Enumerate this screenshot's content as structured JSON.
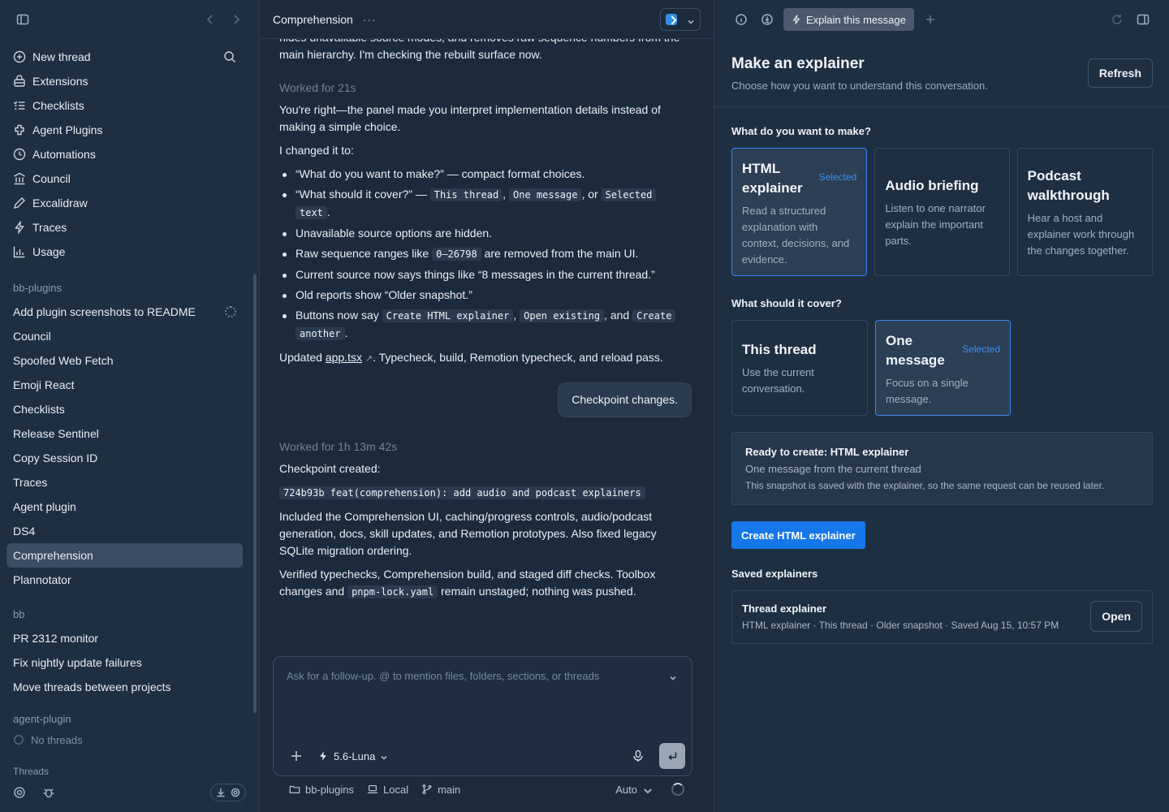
{
  "sidebar": {
    "nav": [
      {
        "label": "New thread",
        "icon": "plus-circle-icon"
      },
      {
        "label": "Extensions",
        "icon": "extensions-icon"
      },
      {
        "label": "Checklists",
        "icon": "checklist-icon"
      },
      {
        "label": "Agent Plugins",
        "icon": "plugin-icon"
      },
      {
        "label": "Automations",
        "icon": "clock-icon"
      },
      {
        "label": "Council",
        "icon": "council-icon"
      },
      {
        "label": "Excalidraw",
        "icon": "pen-icon"
      },
      {
        "label": "Traces",
        "icon": "bolt-icon"
      },
      {
        "label": "Usage",
        "icon": "chart-icon"
      }
    ],
    "groups": [
      {
        "label": "bb-plugins",
        "threads": [
          "Add plugin screenshots to README",
          "Council",
          "Spoofed Web Fetch",
          "Emoji React",
          "Checklists",
          "Release Sentinel",
          "Copy Session ID",
          "Traces",
          "Agent plugin",
          "DS4",
          "Comprehension",
          "Plannotator"
        ]
      },
      {
        "label": "bb",
        "threads": [
          "PR 2312 monitor",
          "Fix nightly update failures",
          "Move threads between projects"
        ]
      },
      {
        "label": "agent-plugin",
        "threads": [
          "No threads"
        ]
      }
    ],
    "cut_label": "Threads"
  },
  "chat": {
    "title": "Comprehension",
    "top_text": "hides unavailable source modes, and removes raw sequence numbers from the main hierarchy. I'm checking the rebuilt surface now.",
    "worked1": "Worked for 21s",
    "p1": "You're right—the panel made you interpret implementation details instead of making a simple choice.",
    "p2": "I changed it to:",
    "bullets": {
      "b1": "“What do you want to make?” — compact format choices.",
      "b2_pre": "“What should it cover?” — ",
      "b2_c1": "This thread",
      "b2_sep1": ", ",
      "b2_c2": "One message",
      "b2_sep2": ", or ",
      "b2_c3a": "Selected",
      "b2_c3b": "text",
      "b2_end": ".",
      "b3": "Unavailable source options are hidden.",
      "b4_pre": "Raw sequence ranges like ",
      "b4_code": "0–26798",
      "b4_post": " are removed from the main UI.",
      "b5": "Current source now says things like “8 messages in the current thread.”",
      "b6": "Old reports show “Older snapshot.”",
      "b7_pre": "Buttons now say ",
      "b7_c1": "Create HTML explainer",
      "b7_sep1": ", ",
      "b7_c2": "Open existing",
      "b7_sep2": ", and ",
      "b7_c3a": "Create",
      "b7_c3b": "another",
      "b7_end": "."
    },
    "updated_pre": "Updated ",
    "updated_link": "app.tsx",
    "updated_post": ". Typecheck, build, Remotion typecheck, and reload pass.",
    "user_msg": "Checkpoint changes.",
    "worked2": "Worked for 1h 13m 42s",
    "cp_label": "Checkpoint created:",
    "cp_code": "724b93b feat(comprehension): add audio and podcast explainers",
    "p3": "Included the Comprehension UI, caching/progress controls, audio/podcast generation, docs, skill updates, and Remotion prototypes. Also fixed legacy SQLite migration ordering.",
    "p4_pre": "Verified typechecks, Comprehension build, and staged diff checks. Toolbox changes and ",
    "p4_code": "pnpm-lock.yaml",
    "p4_post": " remain unstaged; nothing was pushed.",
    "composer_placeholder": "Ask for a follow-up. @ to mention files, folders, sections, or threads",
    "model": "5.6-Luna",
    "footer": {
      "project": "bb-plugins",
      "env": "Local",
      "branch": "main",
      "mode": "Auto"
    }
  },
  "panel": {
    "tab_label": "Explain this message",
    "title": "Make an explainer",
    "subtitle": "Choose how you want to understand this conversation.",
    "refresh": "Refresh",
    "q1": "What do you want to make?",
    "formats": [
      {
        "title": "HTML explainer",
        "desc": "Read a structured explanation with context, decisions, and evidence.",
        "badge": "Selected"
      },
      {
        "title": "Audio briefing",
        "desc": "Listen to one narrator explain the important parts.",
        "badge": ""
      },
      {
        "title": "Podcast walkthrough",
        "desc": "Hear a host and explainer work through the changes together.",
        "badge": ""
      }
    ],
    "q2": "What should it cover?",
    "scopes": [
      {
        "title": "This thread",
        "desc": "Use the current conversation.",
        "badge": ""
      },
      {
        "title": "One message",
        "desc": "Focus on a single message.",
        "badge": "Selected"
      }
    ],
    "ready_title": "Ready to create: HTML explainer",
    "ready_line": "One message from the current thread",
    "ready_note": "This snapshot is saved with the explainer, so the same request can be reused later.",
    "create_btn": "Create HTML explainer",
    "saved_heading": "Saved explainers",
    "saved_item_title": "Thread explainer",
    "saved_item_meta": "HTML explainer · This thread · Older snapshot · Saved Aug 15, 10:57 PM",
    "open_btn": "Open"
  },
  "colors": {
    "accent": "#1677e8",
    "selected_border": "#3b82f6",
    "bg": "#1c2b3c"
  }
}
